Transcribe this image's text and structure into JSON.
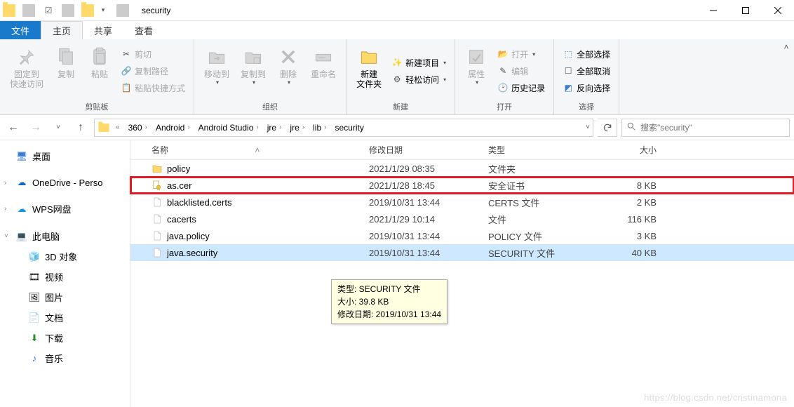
{
  "titlebar": {
    "title": "security"
  },
  "tabs": {
    "file": "文件",
    "home": "主页",
    "share": "共享",
    "view": "查看"
  },
  "ribbon": {
    "pin": "固定到",
    "pin2": "快速访问",
    "copy": "复制",
    "paste": "粘贴",
    "cut": "剪切",
    "copy_path": "复制路径",
    "paste_shortcut": "粘贴快捷方式",
    "group_clipboard": "剪贴板",
    "move_to": "移动到",
    "copy_to": "复制到",
    "delete": "删除",
    "rename": "重命名",
    "group_organize": "组织",
    "new_folder": "新建",
    "new_folder2": "文件夹",
    "new_item": "新建项目",
    "easy_access": "轻松访问",
    "group_new": "新建",
    "properties": "属性",
    "open": "打开",
    "edit": "编辑",
    "history": "历史记录",
    "group_open": "打开",
    "select_all": "全部选择",
    "select_none": "全部取消",
    "invert_selection": "反向选择",
    "group_select": "选择"
  },
  "breadcrumb": {
    "items": [
      "360",
      "Android",
      "Android Studio",
      "jre",
      "jre",
      "lib",
      "security"
    ]
  },
  "search": {
    "placeholder": "搜索\"security\""
  },
  "sidebar": {
    "desktop": "桌面",
    "onedrive": "OneDrive - Perso",
    "wps": "WPS网盘",
    "thispc": "此电脑",
    "objects3d": "3D 对象",
    "videos": "视频",
    "pictures": "图片",
    "documents": "文档",
    "downloads": "下载",
    "music": "音乐"
  },
  "columns": {
    "name": "名称",
    "date": "修改日期",
    "type": "类型",
    "size": "大小"
  },
  "rows": [
    {
      "name": "policy",
      "date": "2021/1/29 08:35",
      "type": "文件夹",
      "size": "",
      "icon": "folder",
      "highlighted": false,
      "selected": false
    },
    {
      "name": "as.cer",
      "date": "2021/1/28 18:45",
      "type": "安全证书",
      "size": "8 KB",
      "icon": "cert",
      "highlighted": true,
      "selected": false
    },
    {
      "name": "blacklisted.certs",
      "date": "2019/10/31 13:44",
      "type": "CERTS 文件",
      "size": "2 KB",
      "icon": "file",
      "highlighted": false,
      "selected": false
    },
    {
      "name": "cacerts",
      "date": "2021/1/29 10:14",
      "type": "文件",
      "size": "116 KB",
      "icon": "file",
      "highlighted": false,
      "selected": false
    },
    {
      "name": "java.policy",
      "date": "2019/10/31 13:44",
      "type": "POLICY 文件",
      "size": "3 KB",
      "icon": "file",
      "highlighted": false,
      "selected": false
    },
    {
      "name": "java.security",
      "date": "2019/10/31 13:44",
      "type": "SECURITY 文件",
      "size": "40 KB",
      "icon": "file",
      "highlighted": false,
      "selected": true
    }
  ],
  "tooltip": {
    "line1": "类型: SECURITY 文件",
    "line2": "大小: 39.8 KB",
    "line3": "修改日期: 2019/10/31 13:44"
  },
  "watermark": "https://blog.csdn.net/cristinamona"
}
